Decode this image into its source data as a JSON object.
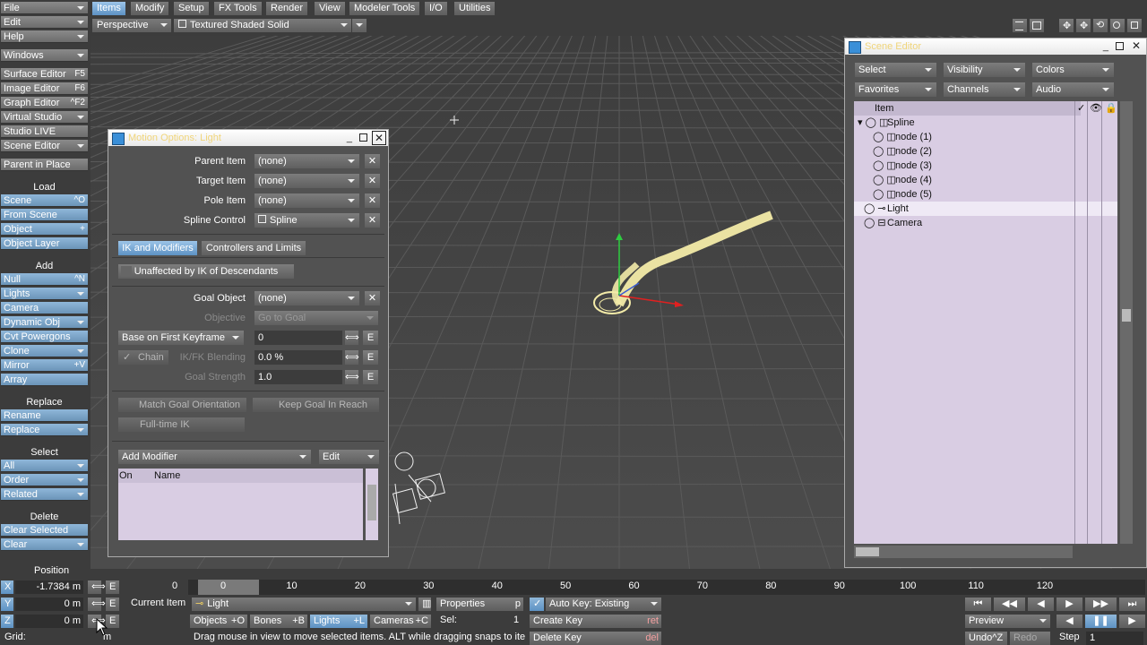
{
  "left_toolbar": {
    "file": "File",
    "edit": "Edit",
    "help": "Help",
    "windows": "Windows",
    "surface_editor": "Surface Editor",
    "surface_editor_key": "F5",
    "image_editor": "Image Editor",
    "image_editor_key": "F6",
    "graph_editor": "Graph Editor",
    "graph_editor_key": "^F2",
    "virtual_studio": "Virtual Studio",
    "studio_live": "Studio LIVE",
    "scene_editor": "Scene Editor",
    "parent_in_place": "Parent in Place",
    "load_heading": "Load",
    "scene": "Scene",
    "scene_key": "^O",
    "from_scene": "From Scene",
    "object": "Object",
    "object_key": "+",
    "object_layer": "Object Layer",
    "add_heading": "Add",
    "null": "Null",
    "null_key": "^N",
    "lights": "Lights",
    "camera": "Camera",
    "dynamic_obj": "Dynamic Obj",
    "cvt_powergons": "Cvt Powergons",
    "clone": "Clone",
    "mirror": "Mirror",
    "mirror_key": "+V",
    "array": "Array",
    "replace_heading": "Replace",
    "rename": "Rename",
    "replace": "Replace",
    "select_heading": "Select",
    "all": "All",
    "order": "Order",
    "related": "Related",
    "delete_heading": "Delete",
    "clear_selected": "Clear Selected",
    "clear": "Clear"
  },
  "top_tabs": [
    "Items",
    "Modify",
    "Setup",
    "FX Tools",
    "Render",
    "View",
    "Modeler Tools",
    "I/O",
    "Utilities"
  ],
  "viewport": {
    "view_mode": "Perspective",
    "shading": "Textured Shaded Solid"
  },
  "motion_panel": {
    "title": "Motion Options: Light",
    "parent_item_label": "Parent Item",
    "parent_item_value": "(none)",
    "target_item_label": "Target Item",
    "target_item_value": "(none)",
    "pole_item_label": "Pole Item",
    "pole_item_value": "(none)",
    "spline_control_label": "Spline Control",
    "spline_control_value": "Spline",
    "tab_ik": "IK and Modifiers",
    "tab_controllers": "Controllers and Limits",
    "unaffected_ik": "Unaffected by IK of Descendants",
    "goal_object_label": "Goal Object",
    "goal_object_value": "(none)",
    "objective_label": "Objective",
    "objective_value": "Go to Goal",
    "base_on": "Base on First Keyframe",
    "base_value": "0",
    "chain": "Chain",
    "ikfk_label": "IK/FK Blending",
    "ikfk_value": "0.0 %",
    "goal_strength_label": "Goal Strength",
    "goal_strength_value": "1.0",
    "match_goal": "Match Goal Orientation",
    "keep_goal": "Keep Goal In Reach",
    "fulltime_ik": "Full-time IK",
    "add_modifier": "Add Modifier",
    "edit": "Edit",
    "col_on": "On",
    "col_name": "Name",
    "e_label": "E"
  },
  "scene_editor": {
    "title": "Scene Editor",
    "select": "Select",
    "visibility": "Visibility",
    "colors": "Colors",
    "favorites": "Favorites",
    "channels": "Channels",
    "audio": "Audio",
    "item_header": "Item",
    "items": [
      "Spline",
      "node (1)",
      "node (2)",
      "node (3)",
      "node (4)",
      "node (5)",
      "Light",
      "Camera"
    ]
  },
  "bottom": {
    "pos_heading": "Position",
    "x_label": "X",
    "x_value": "-1.7384 m",
    "y_label": "Y",
    "y_value": "0 m",
    "z_label": "Z",
    "z_value": "0 m",
    "grid_label": "Grid:",
    "grid_value": "m",
    "timeline_start": "0",
    "ticks": [
      "0",
      "10",
      "20",
      "30",
      "40",
      "50",
      "60",
      "70",
      "80",
      "90",
      "100",
      "110",
      "120"
    ],
    "current_item_label": "Current Item",
    "current_item_value": "Light",
    "properties": "Properties",
    "properties_key": "p",
    "auto_key": "Auto Key: Existing",
    "objects": "Objects",
    "objects_key": "+O",
    "bones": "Bones",
    "bones_key": "+B",
    "lights": "Lights",
    "lights_key": "+L",
    "cameras": "Cameras",
    "cameras_key": "+C",
    "sel_label": "Sel:",
    "sel_value": "1",
    "create_key": "Create Key",
    "create_key_shortcut": "ret",
    "delete_key": "Delete Key",
    "delete_key_shortcut": "del",
    "status": "Drag mouse in view to move selected items. ALT while dragging snaps to ite",
    "preview": "Preview",
    "undo": "Undo^Z",
    "redo": "Redo",
    "step_label": "Step",
    "step_value": "1"
  }
}
